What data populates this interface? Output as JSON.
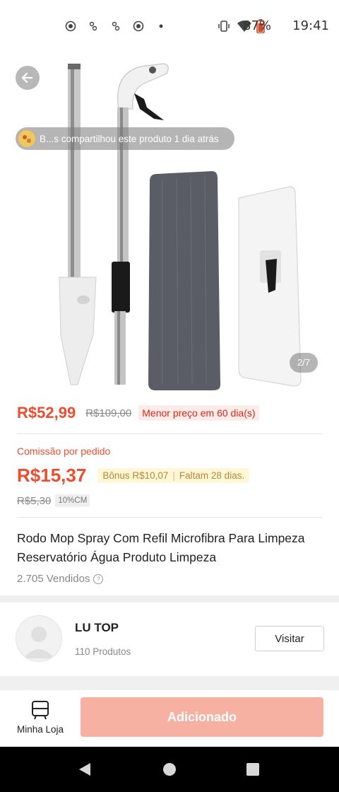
{
  "status_bar": {
    "battery": "87%",
    "time": "19:41"
  },
  "product": {
    "share_banner": "B...s compartilhou este produto 1 dia atrás",
    "image_counter": "2/7",
    "price": "R$52,99",
    "original_price": "R$109,00",
    "lowest_price_tag": "Menor preço em 60 dia(s)",
    "commission_label": "Comissão por pedido",
    "commission_amount": "R$15,37",
    "bonus_text": "Bônus R$10,07",
    "remaining_text": "Faltam 28 dias.",
    "commission_old": "R$5,30",
    "commission_rate": "10%CM",
    "title": "Rodo Mop Spray Com Refil Microfibra Para Limpeza Reservatório Água Produto Limpeza",
    "sold": "2.705 Vendidos"
  },
  "shop": {
    "name": "LU TOP",
    "products": "110 Produtos",
    "visit_label": "Visitar"
  },
  "bottom_bar": {
    "my_store_label": "Minha Loja",
    "add_label": "Adicionado"
  },
  "colors": {
    "accent": "#ee4d2d",
    "add_button": "#f7b1a2",
    "bonus_bg": "#fff7d6"
  },
  "icons": {
    "back": "back-arrow-icon",
    "info": "info-icon",
    "store": "store-icon",
    "nav_back": "nav-back-icon",
    "nav_home": "nav-home-icon",
    "nav_recents": "nav-recents-icon"
  }
}
